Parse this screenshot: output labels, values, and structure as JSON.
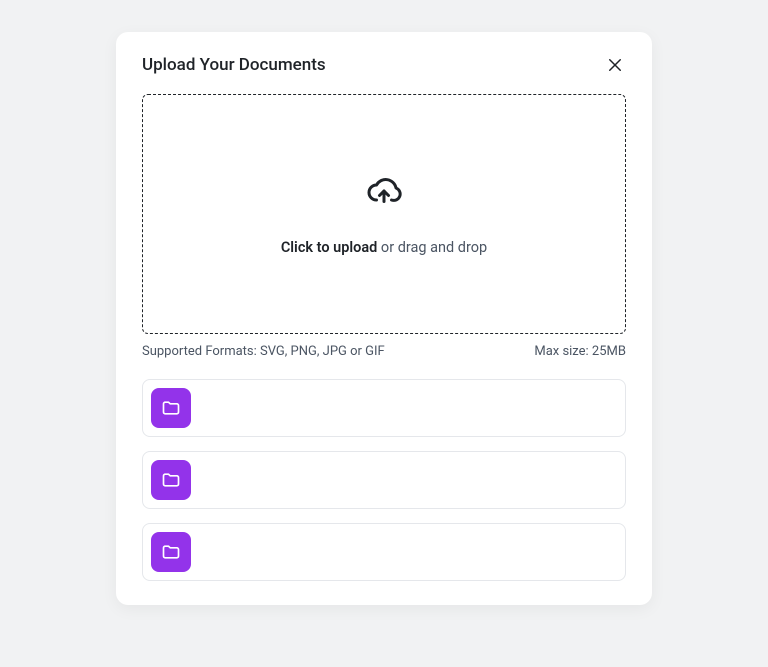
{
  "modal": {
    "title": "Upload Your Documents"
  },
  "dropzone": {
    "click_text": "Click to upload",
    "drag_text": " or drag and drop"
  },
  "hints": {
    "formats": "Supported Formats: SVG, PNG, JPG or GIF",
    "max_size": "Max size: 25MB"
  },
  "rows": [
    {
      "icon": "folder-icon"
    },
    {
      "icon": "folder-icon"
    },
    {
      "icon": "folder-icon"
    }
  ]
}
